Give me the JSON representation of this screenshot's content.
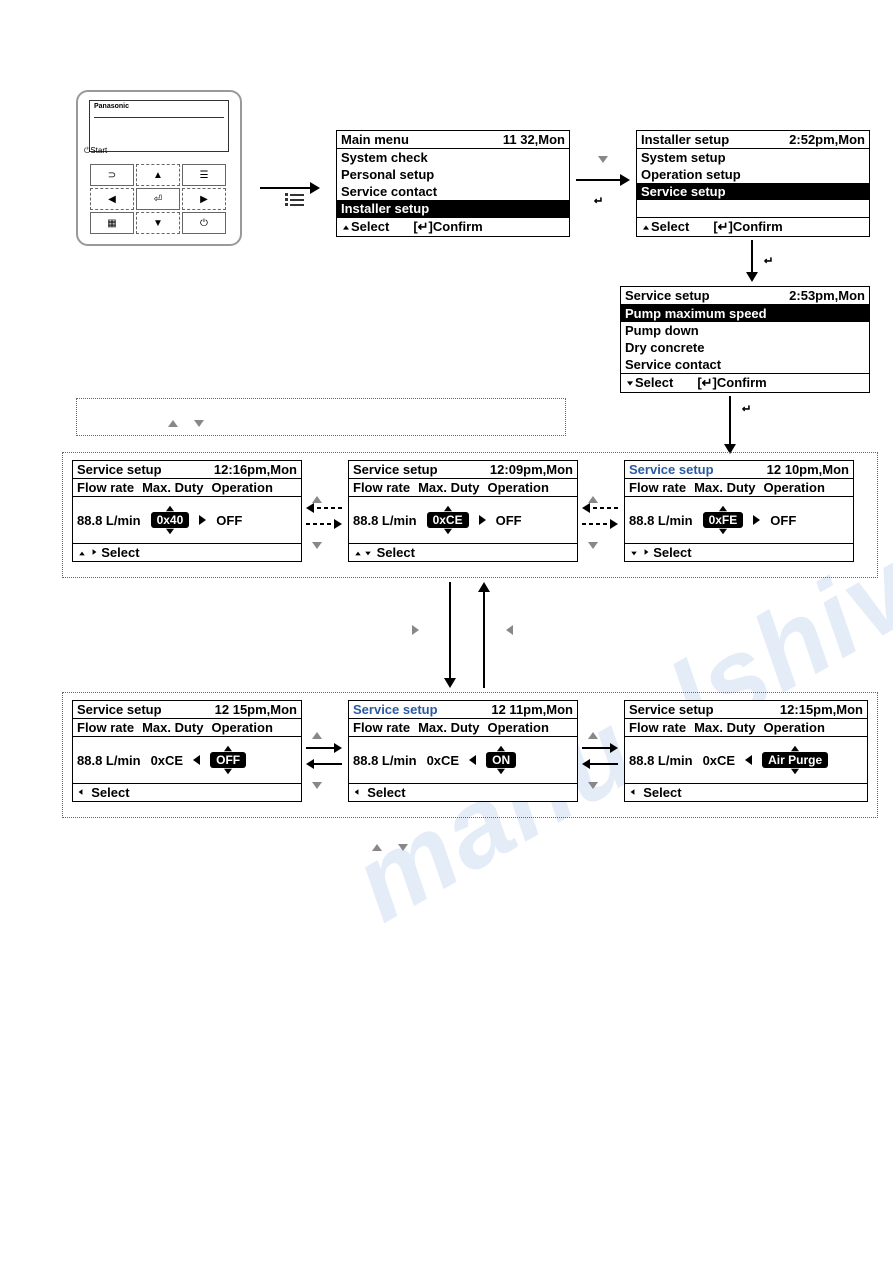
{
  "watermark": "manualshive.com",
  "controller": {
    "brand": "Panasonic",
    "start": "⏻Start"
  },
  "mainMenu": {
    "title": "Main menu",
    "time": "11 32,Mon",
    "items": [
      "System check",
      "Personal setup",
      "Service contact",
      "Installer setup"
    ],
    "selIndex": 3,
    "footSelect": "Select",
    "footConfirm": "[↵]Confirm"
  },
  "installerSetup": {
    "title": "Installer setup",
    "time": "2:52pm,Mon",
    "items": [
      "System setup",
      "Operation setup",
      "Service setup"
    ],
    "selIndex": 2,
    "footSelect": "Select",
    "footConfirm": "[↵]Confirm"
  },
  "serviceSetupMenu": {
    "title": "Service setup",
    "time": "2:53pm,Mon",
    "items": [
      "Pump maximum speed",
      "Pump down",
      "Dry concrete",
      "Service contact"
    ],
    "selIndex": 0,
    "footSelect": "Select",
    "footConfirm": "[↵]Confirm"
  },
  "cols": {
    "c1": "Flow rate",
    "c2": "Max. Duty",
    "c3": "Operation"
  },
  "flowUnit": "88.8 L/min",
  "panels": {
    "p1": {
      "title": "Service setup",
      "time": "12:16pm,Mon",
      "duty": "0x40",
      "op": "OFF",
      "foot": "Select",
      "dutyBadge": true,
      "opBadge": false,
      "arrow": "r",
      "spin": "duty"
    },
    "p2": {
      "title": "Service setup",
      "time": "12:09pm,Mon",
      "duty": "0xCE",
      "op": "OFF",
      "foot": "Select",
      "dutyBadge": true,
      "opBadge": false,
      "arrow": "r",
      "spin": "both"
    },
    "p3": {
      "title": "Service setup",
      "time": "12 10pm,Mon",
      "duty": "0xFE",
      "op": "OFF",
      "foot": "Select",
      "dutyBadge": true,
      "opBadge": false,
      "arrow": "r",
      "spin": "duty"
    },
    "p4": {
      "title": "Service setup",
      "time": "12 15pm,Mon",
      "duty": "0xCE",
      "op": "OFF",
      "foot": "Select",
      "dutyBadge": false,
      "opBadge": true,
      "arrow": "l",
      "spin": "op"
    },
    "p5": {
      "title": "Service setup",
      "time": "12 11pm,Mon",
      "duty": "0xCE",
      "op": "ON",
      "foot": "Select",
      "dutyBadge": false,
      "opBadge": true,
      "arrow": "l",
      "spin": "op"
    },
    "p6": {
      "title": "Service setup",
      "time": "12:15pm,Mon",
      "duty": "0xCE",
      "op": "Air Purge",
      "foot": "Select",
      "dutyBadge": false,
      "opBadge": true,
      "arrow": "l",
      "spin": "op"
    }
  }
}
